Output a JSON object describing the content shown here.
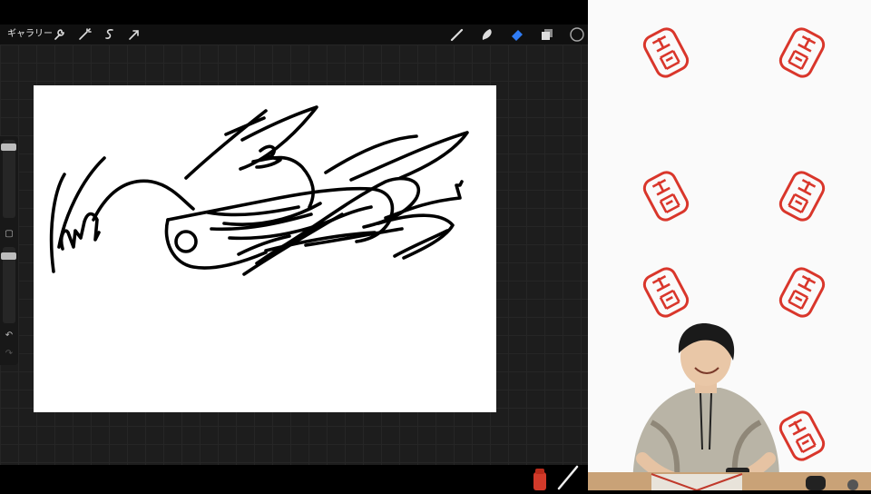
{
  "toolbar": {
    "gallery_label": "ギャラリー",
    "left_tools": [
      "wrench-icon",
      "magic-wand-icon",
      "selection-icon",
      "transform-arrow-icon"
    ],
    "right_tools": [
      "brush-icon",
      "smudge-icon",
      "eraser-icon",
      "layers-icon",
      "color-swatch"
    ],
    "accent_color": "#2f7cf6"
  },
  "stream": {
    "stamp_text": "岩崎",
    "stamp_color": "#d9362b",
    "background_color": "#fafafa"
  }
}
